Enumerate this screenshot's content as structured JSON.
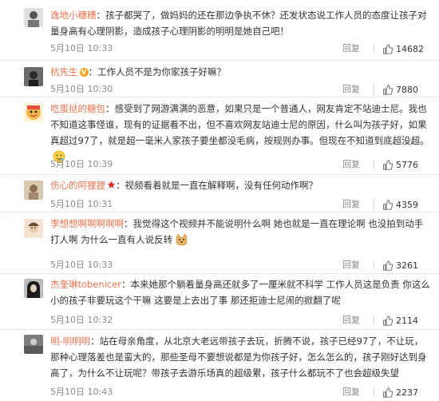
{
  "comments": [
    {
      "user": "逸地小穗穗",
      "text": "孩子都哭了，做妈妈的还在那边争执不休？还发状态说工作人员的态度让孩子对量身高有心理阴影，造成孩子心理阴影的明明是她自己吧！",
      "time": "5月10日 10:33",
      "reply": "回复",
      "likes": "14682",
      "badge": "",
      "avatar_color": "#d8d8d8"
    },
    {
      "user": "杭先生",
      "text": "工作人员不是为你家孩子好嘛？",
      "time": "5月10日 10:30",
      "reply": "回复",
      "likes": "7880",
      "badge": "V",
      "avatar_color": "#5a5a5a"
    },
    {
      "user": "吃蛋挞的糖包",
      "text": "感受到了网游满满的恶意，如果只是一个普通人，网友肯定不站迪士尼。我也不知道这事怪谁，现有的证据看不出，但不喜欢网友站迪士尼的原因，什么叫为孩子好，如果真超过97了，就是超一毫米人家孩子要坐都没毛病，按规则办事。但现在不知道到底超没超。",
      "time": "5月10日 10:39",
      "reply": "回复",
      "likes": "5776",
      "badge": "",
      "avatar_color": "#f2b84b"
    },
    {
      "user": "伤心的阿狸狸",
      "text": "视频看着就是一直在解释啊，没有任何动作啊？",
      "time": "5月10日 10:31",
      "reply": "回复",
      "likes": "4359",
      "badge": "star",
      "avatar_color": "#c9b29a"
    },
    {
      "user": "李想想啊啊啊啊啊",
      "text": "我觉得这个视频并不能说明什么啊 她也就是一直在理论啊 也没拍到动手打人啊 为什么一直有人说反转",
      "time": "5月10日 10:33",
      "reply": "回复",
      "likes": "3261",
      "badge": "",
      "avatar_color": "#e7c9a9"
    },
    {
      "user": "杰奎琳tobenicer",
      "text": "本来她那个躺着量身高还就多了一厘米就不科学 工作人员这是负责 你这么小的孩子非要玩这个干嘛 这要是上去出了事 那还拒迪士尼闹的掀翻了呢",
      "time": "5月10日 10:32",
      "reply": "回复",
      "likes": "2114",
      "badge": "",
      "avatar_color": "#3a3a3a"
    },
    {
      "user": "明-明明明",
      "text": "站在母亲角度，从北京大老远带孩子去玩，折腾不说，孩子已经97了，不让玩，那种心理落差也是蛮大的，那些圣母不要想说都是为你孩子好，怎么怎么的，孩子刚好达到身高了，为什么不让玩呢？带孩子去游乐场真的超级累，孩子什么都玩不了也会超级失望",
      "time": "5月10日 10:43",
      "reply": "回复",
      "likes": "2237",
      "badge": "",
      "avatar_color": "#8f8f8f"
    }
  ]
}
